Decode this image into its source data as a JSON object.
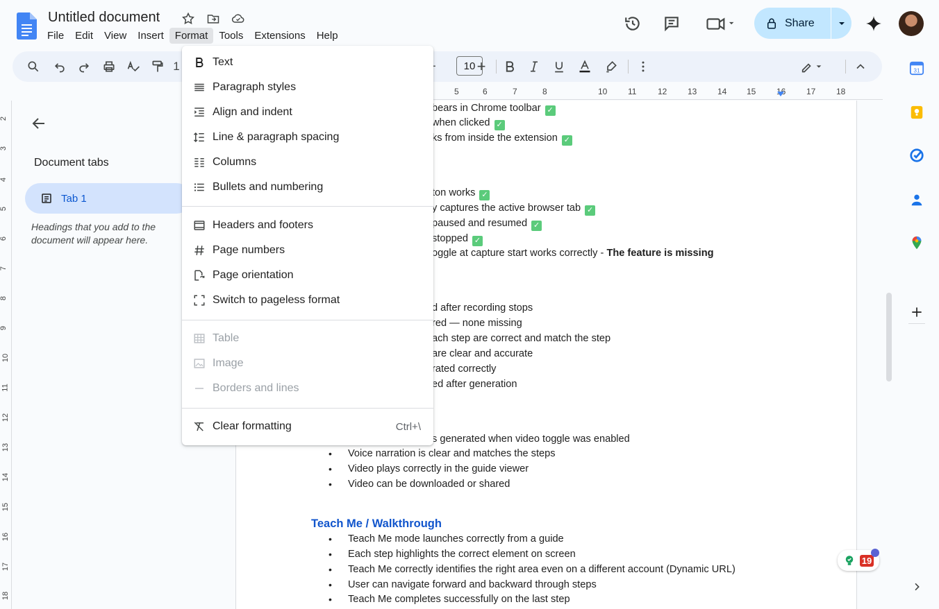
{
  "header": {
    "title": "Untitled document",
    "menus": [
      "File",
      "Edit",
      "View",
      "Insert",
      "Format",
      "Tools",
      "Extensions",
      "Help"
    ],
    "active_menu": "Format",
    "share_label": "Share"
  },
  "toolbar": {
    "font_size": "10",
    "minus": "−",
    "plus": "+",
    "one": "1"
  },
  "ruler": {
    "top_ticks": [
      "5",
      "6",
      "7",
      "8",
      "10",
      "11",
      "12",
      "13",
      "14",
      "15",
      "16",
      "17",
      "18"
    ],
    "left_ticks": [
      "2",
      "3",
      "4",
      "5",
      "6",
      "7",
      "8",
      "9",
      "10",
      "11",
      "12",
      "13",
      "14",
      "15",
      "16",
      "17",
      "18"
    ]
  },
  "left_panel": {
    "title": "Document tabs",
    "tab_label": "Tab 1",
    "hint": "Headings that you add to the document will appear here."
  },
  "document": {
    "lines_top": [
      {
        "text": "bears in Chrome toolbar",
        "check": true
      },
      {
        "text": "when clicked",
        "check": true
      },
      {
        "text": "ks from inside the extension",
        "check": true
      },
      {
        "text": "ton works",
        "check": true
      },
      {
        "text": "y captures the active browser tab",
        "check": true
      },
      {
        "text": "paused and resumed",
        "check": true
      },
      {
        "text": "stopped",
        "check": true
      },
      {
        "text": "oggle at capture start works correctly - ",
        "bold": "The feature is missing"
      },
      {
        "text": "d after recording stops"
      },
      {
        "text": "red — none missing"
      },
      {
        "text": "ach step are correct and match the step"
      },
      {
        "text": "are clear and accurate"
      },
      {
        "text": "rated correctly"
      },
      {
        "text": "ed after generation"
      },
      {
        "text": "s generated when video toggle was enabled"
      }
    ],
    "bullets_video": [
      "Voice narration is clear and matches the steps",
      "Video plays correctly in the guide viewer",
      "Video can be downloaded or shared"
    ],
    "heading": "Teach Me / Walkthrough",
    "bullets_teach": [
      "Teach Me mode launches correctly from a guide",
      "Each step highlights the correct element on screen",
      "Teach Me correctly identifies the right area even on a different account (Dynamic URL)",
      "User can navigate forward and backward through steps",
      "Teach Me completes successfully on the last step"
    ]
  },
  "format_menu": {
    "items": [
      {
        "label": "Text",
        "icon": "bold-b-icon"
      },
      {
        "label": "Paragraph styles",
        "icon": "paragraph-lines-icon"
      },
      {
        "label": "Align and indent",
        "icon": "indent-icon"
      },
      {
        "label": "Line & paragraph spacing",
        "icon": "line-spacing-icon"
      },
      {
        "label": "Columns",
        "icon": "columns-icon"
      },
      {
        "label": "Bullets and numbering",
        "icon": "bulleted-list-icon"
      },
      {
        "label": "Headers and footers",
        "icon": "header-footer-icon"
      },
      {
        "label": "Page numbers",
        "icon": "hash-icon"
      },
      {
        "label": "Page orientation",
        "icon": "page-orientation-icon"
      },
      {
        "label": "Switch to pageless format",
        "icon": "pageless-icon"
      },
      {
        "label": "Table",
        "icon": "table-icon",
        "disabled": true
      },
      {
        "label": "Image",
        "icon": "image-icon",
        "disabled": true
      },
      {
        "label": "Borders and lines",
        "icon": "dash-icon",
        "disabled": true
      },
      {
        "label": "Clear formatting",
        "icon": "clear-format-icon",
        "shortcut": "Ctrl+\\"
      }
    ]
  },
  "badge": {
    "count": "19"
  },
  "colors": {
    "accent": "#0b57d0",
    "share_bg": "#c2e7ff",
    "heading": "#1155cc",
    "check": "#5bcb7b"
  }
}
